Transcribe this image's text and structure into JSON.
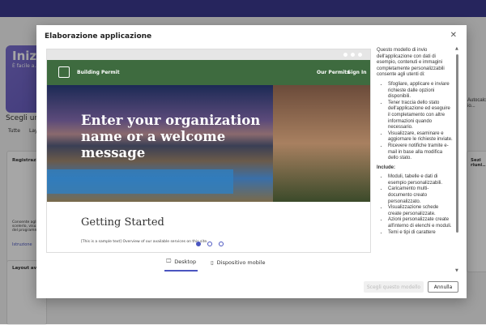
{
  "background": {
    "hero_title": "Inizia",
    "hero_text": "È facile a... che desid...",
    "section_title": "Scegli un m...",
    "tabs": [
      "Tutte",
      "Lay..."
    ],
    "card1_title": "Registrazio...",
    "card1_text": "Consente agli... scelerlo, visu... del programm...",
    "card1_link": "Istruzione",
    "card2_title": "Layout avv...",
    "right_card_title": "Sezi riuni...",
    "right_text": "Autocalcio..."
  },
  "modal": {
    "title": "Elaborazione applicazione",
    "close_icon": "close-icon",
    "preview": {
      "brand": "Building Permit",
      "nav_links": [
        "Our Permits",
        "Sign In"
      ],
      "hero_text": "Enter your organization name or a welcome message",
      "heading": "Getting Started",
      "sample_text": "[This is a sample text] Overview of our available services on this site.",
      "pages": 3,
      "current_page": 1
    },
    "view_tabs": [
      {
        "label": "Desktop",
        "icon": "monitor-icon",
        "active": true
      },
      {
        "label": "Dispositivo mobile",
        "icon": "phone-icon",
        "active": false
      }
    ],
    "description": {
      "intro": "Questo modello di invio dell'applicazione con dati di esempio, contenuti e immagini completamente personalizzabili consente agli utenti di:",
      "features": [
        "Sfogliare, applicare e inviare richieste dalle opzioni disponibili.",
        "Tener traccia dello stato dell'applicazione ed eseguire il completamento con altre informazioni quando necessario.",
        "Visualizzare, esaminare e aggiornare le richieste inviate.",
        "Ricevere notifiche tramite e-mail in base alla modifica dello stato."
      ],
      "includes_title": "Include:",
      "includes": [
        "Moduli, tabelle e dati di esempio personalizzabili.",
        "Caricamento multi-documento creato personalizzato.",
        "Visualizzazione schede create personalizzate.",
        "Azioni personalizzate create all'interno di elenchi e moduli.",
        "Temi e tipi di carattere"
      ]
    },
    "buttons": {
      "primary": "Scegli questo modello",
      "cancel": "Annulla"
    }
  }
}
